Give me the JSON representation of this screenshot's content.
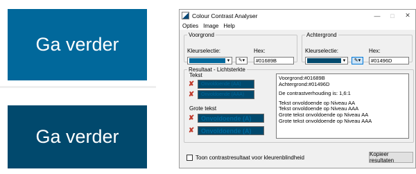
{
  "samples": [
    {
      "label": "Ga verder",
      "bg": "#01689B"
    },
    {
      "label": "Ga verder",
      "bg": "#01496D"
    }
  ],
  "window": {
    "title": "Colour Contrast Analyser",
    "menu": [
      "Opties",
      "Image",
      "Help"
    ],
    "foreground": {
      "legend": "Voorgrond",
      "selection_label": "Kleurselectie:",
      "hex_label": "Hex:",
      "hex_value": "#01689B",
      "color": "#01689B"
    },
    "background": {
      "legend": "Achtergrond",
      "selection_label": "Kleurselectie:",
      "hex_label": "Hex:",
      "hex_value": "#01496D",
      "color": "#01496D"
    },
    "results": {
      "legend": "Resultaat - Lichtsterkte",
      "text_label": "Tekst",
      "large_text_label": "Grote tekst",
      "small_boxes": [
        "Onvoldoende (AA)",
        "Onvoldoende (AAA)"
      ],
      "large_boxes": [
        "Onvoldoende (A)",
        "Onvoldoende (A)"
      ],
      "report_lines": [
        "Voorgrond:#01689B",
        "Achtergrond:#01496D",
        "",
        "De contrastverhouding is: 1,6:1",
        "",
        "Tekst onvoldoende op Niveau AA",
        "Tekst onvoldoende op Niveau AAA",
        "Grote tekst onvoldoende op Niveau AA",
        "Grote tekst onvoldoende op Niveau AAA"
      ]
    },
    "checkbox_label": "Toon contrastresultaat voor kleurenblindheid",
    "copy_button": "Kopieer resultaten"
  },
  "icons": {
    "fail": "x-mark-icon",
    "picker": "eyedropper-icon",
    "window_controls": [
      "minimize-icon",
      "maximize-icon",
      "close-icon"
    ]
  }
}
